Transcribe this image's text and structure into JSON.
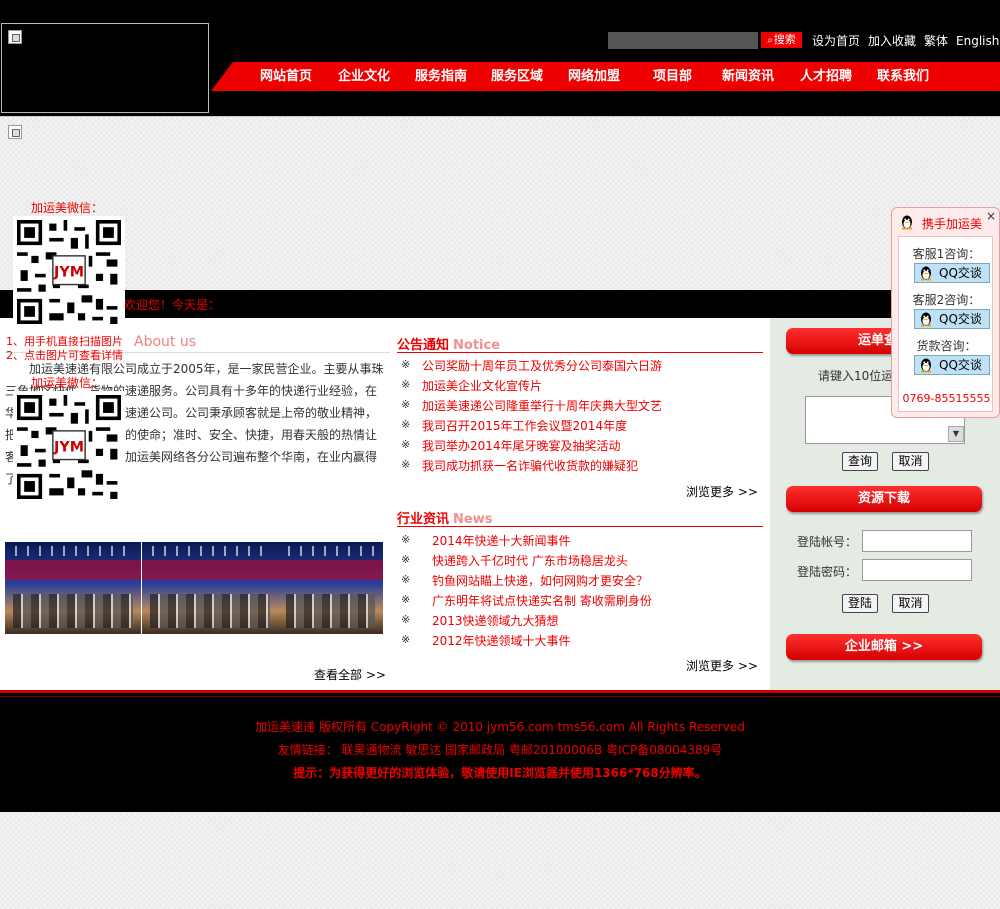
{
  "header": {
    "search": {
      "button_label": "搜索",
      "placeholder": ""
    },
    "toplinks": [
      "设为首页",
      "加入收藏",
      "繁体",
      "English"
    ]
  },
  "nav": [
    "网站首页",
    "企业文化",
    "服务指南",
    "服务区域",
    "网络加盟",
    "项目部",
    "新闻资讯",
    "人才招聘",
    "联系我们"
  ],
  "welcome": "欢迎您！今天是：",
  "about": {
    "title": "About us",
    "text": "加运美速递有限公司成立于2005年，是一家民营企业。主要从事珠三角地区快件、货物的速递服务。公司具有十多年的快递行业经验，在华南是家喻户晓的物流速递公司。公司秉承顾客就是上帝的敬业精神，把客户的需求当做公司的使命；准时、安全、快捷，用春天般的热情让客户享受优质的服务。加运美网络各分公司遍布整个华南，在业内赢得了市场……",
    "view_all": "查看全部 >>"
  },
  "notice": {
    "title": "公告通知",
    "title_en": "Notice",
    "mark": "※",
    "items": [
      "公司奖励十周年员工及优秀分公司泰国六日游",
      "加运美企业文化宣传片",
      "加运美速递公司隆重举行十周年庆典大型文艺",
      "我司召开2015年工作会议暨2014年度",
      "我司举办2014年尾牙晚宴及抽奖活动",
      "我司成功抓获一名诈骗代收货款的嫌疑犯"
    ],
    "more": "浏览更多 >>"
  },
  "news": {
    "title": "行业资讯",
    "title_en": "News",
    "items": [
      "2014年快递十大新闻事件",
      "快递跨入千亿时代 广东市场稳居龙头",
      "钓鱼网站瞄上快递，如何网购才更安全？",
      "广东明年将试点快递实名制 寄收需刷身份",
      "2013快递领域九大猜想",
      "2012年快递领域十大事件"
    ],
    "more": "浏览更多 >>"
  },
  "tracking": {
    "title": "运单查询",
    "hint": "请键入10位运单号",
    "query_btn": "查询",
    "cancel_btn": "取消"
  },
  "download": {
    "title": "资源下载",
    "account_label": "登陆帐号：",
    "password_label": "登陆密码：",
    "login_btn": "登陆",
    "cancel_btn": "取消"
  },
  "email": {
    "title": "企业邮箱 >>"
  },
  "footer": {
    "copyright": "加运美速递 版权所有 CopyRight © 2010 jym56.com tms56.com All Rights Reserved",
    "links": "友情链接： 联昊通物流 敏思达 国家邮政局 粤邮20100006B 粤ICP备08004389号",
    "tip": "提示：为获得更好的浏览体验，敬请使用IE浏览器并使用1366*768分辨率。"
  },
  "qr": {
    "label1": "加运美微信：",
    "label2": "加运美微信：",
    "hint1": "1、用手机直接扫描图片",
    "hint2": "2、点击图片可查看详情"
  },
  "qq": {
    "title": "携手加运美",
    "close": "×",
    "services": [
      {
        "label": "客服1咨询：",
        "btn": "QQ交谈"
      },
      {
        "label": "客服2咨询：",
        "btn": "QQ交谈"
      },
      {
        "label": "货款咨询：",
        "btn": "QQ交谈"
      }
    ],
    "phone": "0769-85515555"
  },
  "colors": {
    "accent": "#ee0000",
    "dark": "#000000",
    "right_bg": "#e4ebe2"
  }
}
